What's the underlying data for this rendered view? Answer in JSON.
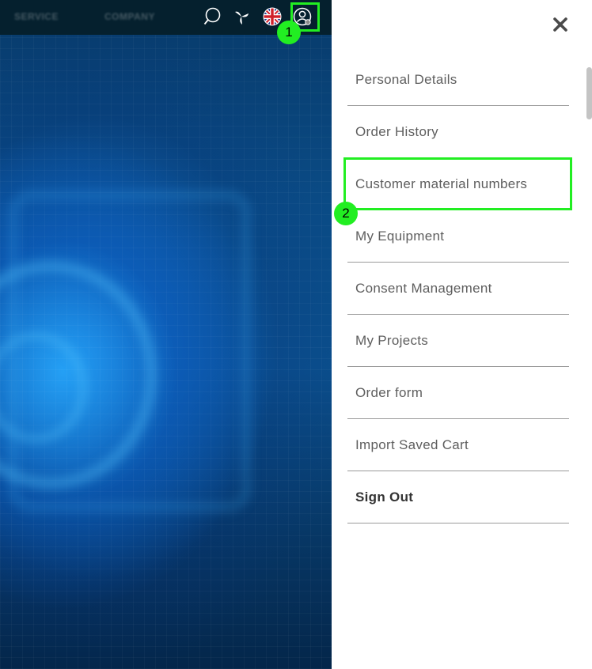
{
  "header": {
    "nav_items": [
      "SERVICE",
      "COMPANY"
    ],
    "icons": [
      "search-icon",
      "brand-logo-icon",
      "uk-flag-icon",
      "user-account-icon"
    ]
  },
  "annotations": {
    "marker_1": "1",
    "marker_2": "2",
    "highlight_color": "#22ee22"
  },
  "account_menu": {
    "close_icon": "close-icon",
    "items": [
      {
        "label": "Personal Details"
      },
      {
        "label": "Order History"
      },
      {
        "label": "Customer material numbers"
      },
      {
        "label": "My Equipment"
      },
      {
        "label": "Consent Management"
      },
      {
        "label": "My Projects"
      },
      {
        "label": "Order form"
      },
      {
        "label": "Import Saved Cart"
      },
      {
        "label": "Sign Out"
      }
    ]
  },
  "colors": {
    "topbar": "#05202e",
    "hero_blue": "#0b4f8c",
    "menu_text": "#5e5e5e",
    "divider": "#9a9a9a"
  }
}
